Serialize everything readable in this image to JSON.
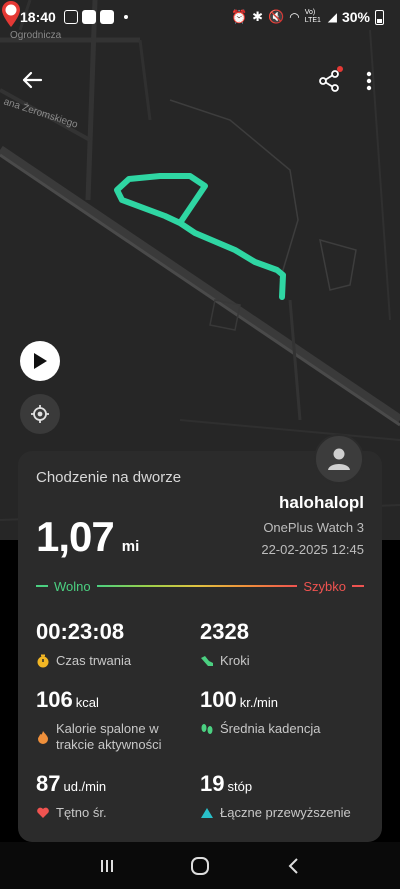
{
  "status_bar": {
    "time": "18:40",
    "network": "Vo) LTE1",
    "battery": "30%"
  },
  "map": {
    "street_1": "Ogrodnicza",
    "street_2": "ana Żeromskiego",
    "route_color": "#2fd6a3"
  },
  "activity": {
    "title": "Chodzenie na dworze",
    "username": "halohalopl",
    "device": "OnePlus Watch 3",
    "datetime": "22-02-2025 12:45",
    "distance_value": "1,07",
    "distance_unit": "mi",
    "pace_slow": "Wolno",
    "pace_fast": "Szybko"
  },
  "stats": {
    "duration": {
      "value": "00:23:08",
      "label": "Czas trwania"
    },
    "steps": {
      "value": "2328",
      "label": "Kroki"
    },
    "calories": {
      "value": "106",
      "unit": "kcal",
      "label": "Kalorie spalone w trakcie aktywności"
    },
    "cadence": {
      "value": "100",
      "unit": "kr./min",
      "label": "Średnia kadencja"
    },
    "heart_rate": {
      "value": "87",
      "unit": "ud./min",
      "label": "Tętno śr."
    },
    "elevation": {
      "value": "19",
      "unit": "stóp",
      "label": "Łączne przewyższenie"
    }
  },
  "icons": {
    "back": "arrow-left-icon",
    "share": "share-icon",
    "more": "more-vertical-icon",
    "play": "play-icon",
    "locate": "locate-icon"
  },
  "colors": {
    "slow": "#4bd081",
    "fast": "#ef5350",
    "card_bg": "#2b2b2b"
  }
}
